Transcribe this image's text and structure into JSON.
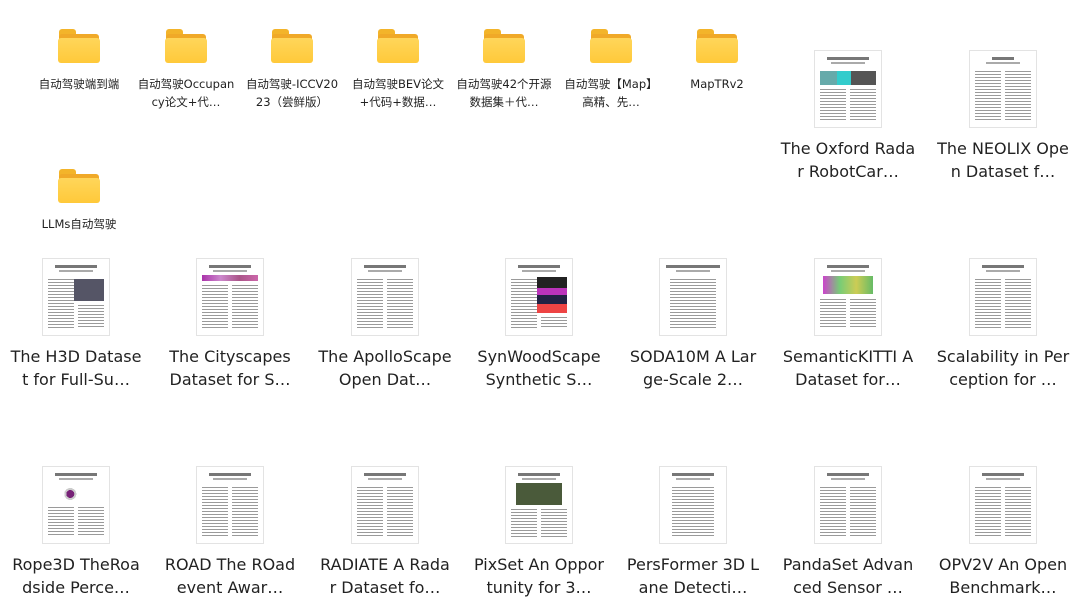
{
  "folders": [
    {
      "label": "自动驾驶端到端"
    },
    {
      "label": "自动驾驶Occupancy论文+代…"
    },
    {
      "label": "自动驾驶-ICCV2023（尝鲜版）"
    },
    {
      "label": "自动驾驶BEV论文+代码+数据…"
    },
    {
      "label": "自动驾驶42个开源数据集＋代…"
    },
    {
      "label": "自动驾驶【Map】高精、先…"
    },
    {
      "label": "MapTRv2"
    },
    {
      "label": "LLMs自动驾驶"
    }
  ],
  "files": [
    {
      "label": "The Oxford Radar RobotCar…",
      "icon": "pdf-thumbnail-icon"
    },
    {
      "label": "The NEOLIX Open Dataset f…",
      "icon": "pdf-thumbnail-icon"
    },
    {
      "label": "The H3D Dataset for Full-Su…",
      "icon": "pdf-thumbnail-icon"
    },
    {
      "label": "The Cityscapes Dataset for S…",
      "icon": "pdf-thumbnail-icon"
    },
    {
      "label": "The ApolloScape Open Dat…",
      "icon": "pdf-thumbnail-icon"
    },
    {
      "label": "SynWoodScape Synthetic S…",
      "icon": "pdf-thumbnail-icon"
    },
    {
      "label": "SODA10M A Large-Scale 2…",
      "icon": "pdf-thumbnail-icon"
    },
    {
      "label": "SemanticKITTI A Dataset for…",
      "icon": "pdf-thumbnail-icon"
    },
    {
      "label": "Scalability in Perception for …",
      "icon": "pdf-thumbnail-icon"
    },
    {
      "label": "Rope3D TheRoadside Perce…",
      "icon": "pdf-thumbnail-icon"
    },
    {
      "label": "ROAD The ROad event Awar…",
      "icon": "pdf-thumbnail-icon"
    },
    {
      "label": "RADIATE A Radar Dataset fo…",
      "icon": "pdf-thumbnail-icon"
    },
    {
      "label": "PixSet An Opportunity for 3…",
      "icon": "pdf-thumbnail-icon"
    },
    {
      "label": "PersFormer 3D Lane Detecti…",
      "icon": "pdf-thumbnail-icon"
    },
    {
      "label": "PandaSet Advanced Sensor …",
      "icon": "pdf-thumbnail-icon"
    },
    {
      "label": "OPV2V An Open Benchmark…",
      "icon": "pdf-thumbnail-icon"
    }
  ],
  "colors": {
    "folder": "#ffc93a",
    "text": "#222222",
    "background": "#ffffff"
  }
}
